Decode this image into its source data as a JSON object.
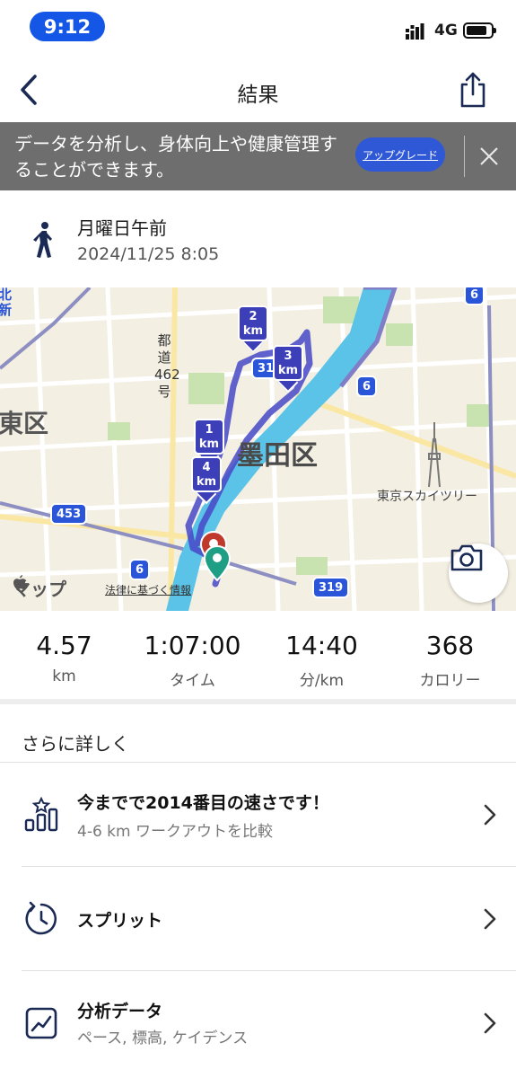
{
  "status_bar": {
    "time": "9:12",
    "network": "4G"
  },
  "nav": {
    "title": "結果"
  },
  "banner": {
    "text": "データを分析し、身体向上や健康管理することができます。",
    "upgrade_label": "アップグレード"
  },
  "workout": {
    "title": "月曜日午前",
    "datetime": "2024/11/25 8:05"
  },
  "map": {
    "ward_left": "東区",
    "ward_right": "墨田区",
    "landmark": "東京スカイツリー",
    "vertical_road": "都道462号",
    "corner_text": "北新",
    "brand": "マップ",
    "legal": "法律に基づく情報",
    "road_numbers": [
      "6",
      "6",
      "6",
      "453",
      "319",
      "319"
    ],
    "km_markers": [
      {
        "line1": "1",
        "line2": "km"
      },
      {
        "line1": "2",
        "line2": "km"
      },
      {
        "line1": "3",
        "line2": "km"
      },
      {
        "line1": "4",
        "line2": "km"
      }
    ],
    "colors": {
      "route": "#4648c8",
      "river": "#5cc3e8",
      "start_pin": "#c0392b",
      "end_pin": "#1e9e85"
    }
  },
  "stats": [
    {
      "value": "4.57",
      "label": "km"
    },
    {
      "value": "1:07:00",
      "label": "タイム"
    },
    {
      "value": "14:40",
      "label": "分/km"
    },
    {
      "value": "368",
      "label": "カロリー"
    }
  ],
  "details": {
    "section_title": "さらに詳しく",
    "rows": [
      {
        "icon": "ranking-chart-icon",
        "title": "今までで2014番目の速さです！",
        "subtitle": "4-6 km ワークアウトを比較"
      },
      {
        "icon": "split-timer-icon",
        "title": "スプリット",
        "subtitle": ""
      },
      {
        "icon": "analysis-chart-icon",
        "title": "分析データ",
        "subtitle": "ペース, 標高, ケイデンス"
      }
    ]
  },
  "theme": {
    "accent": "#1456e6",
    "banner_bg": "#6e6e6e",
    "upgrade_bg": "#2e58d6",
    "icon_navy": "#1b2a55"
  }
}
